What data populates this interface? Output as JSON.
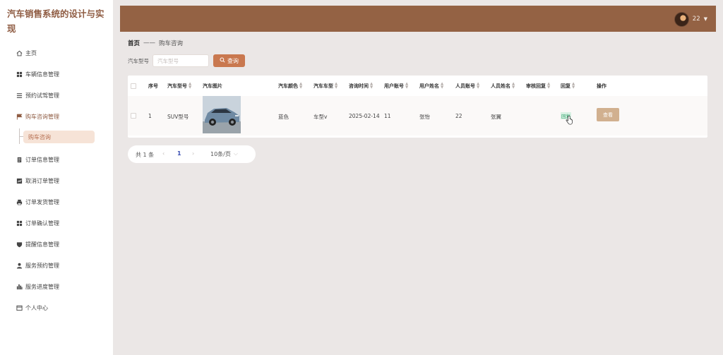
{
  "app": {
    "title": "汽车销售系统的设计与实现"
  },
  "sidebar": {
    "items": [
      {
        "label": "主页",
        "icon": "home-icon"
      },
      {
        "label": "车辆信息管理",
        "icon": "grid-icon"
      },
      {
        "label": "预约试驾管理",
        "icon": "list-icon"
      },
      {
        "label": "购车咨询管理",
        "icon": "flag-icon"
      },
      {
        "label": "订单信息管理",
        "icon": "document-icon"
      },
      {
        "label": "取消订单管理",
        "icon": "chart-icon"
      },
      {
        "label": "订单发货管理",
        "icon": "printer-icon"
      },
      {
        "label": "订单确认管理",
        "icon": "grid-icon"
      },
      {
        "label": "提醒信息管理",
        "icon": "shield-icon"
      },
      {
        "label": "服务预约管理",
        "icon": "user-icon"
      },
      {
        "label": "服务进度管理",
        "icon": "bar-chart-icon"
      },
      {
        "label": "个人中心",
        "icon": "window-icon"
      }
    ],
    "submenu": {
      "label": "购车咨询"
    }
  },
  "header": {
    "username": "22"
  },
  "breadcrumb": {
    "home": "首页",
    "separator": "——",
    "current": "购车咨询"
  },
  "search": {
    "label": "汽车型号",
    "placeholder": "汽车型号",
    "button_label": "查询"
  },
  "table": {
    "columns": [
      "序号",
      "汽车型号",
      "汽车图片",
      "汽车颜色",
      "汽车车型",
      "咨询时间",
      "用户账号",
      "用户姓名",
      "人员账号",
      "人员姓名",
      "审核回复",
      "回复",
      "操作"
    ],
    "rows": [
      {
        "index": "1",
        "car_model": "SUV型号",
        "car_color": "蓝色",
        "car_type": "车型v",
        "consult_time": "2025-02-14",
        "user_account": "11",
        "user_name": "张怡",
        "staff_account": "22",
        "staff_name": "张翼",
        "review_reply": "",
        "reply": "回复",
        "action": "查看"
      }
    ]
  },
  "pagination": {
    "total": "共 1 条",
    "prev": "‹",
    "current_page": "1",
    "next": "›",
    "page_size": "10条/页",
    "size_chevron": "⌵"
  },
  "colors": {
    "brand": "#946244",
    "accent": "#c9784f",
    "view_button": "#d1b08f",
    "page_active": "#3b4fb3",
    "reply_green": "#2fa36b"
  }
}
